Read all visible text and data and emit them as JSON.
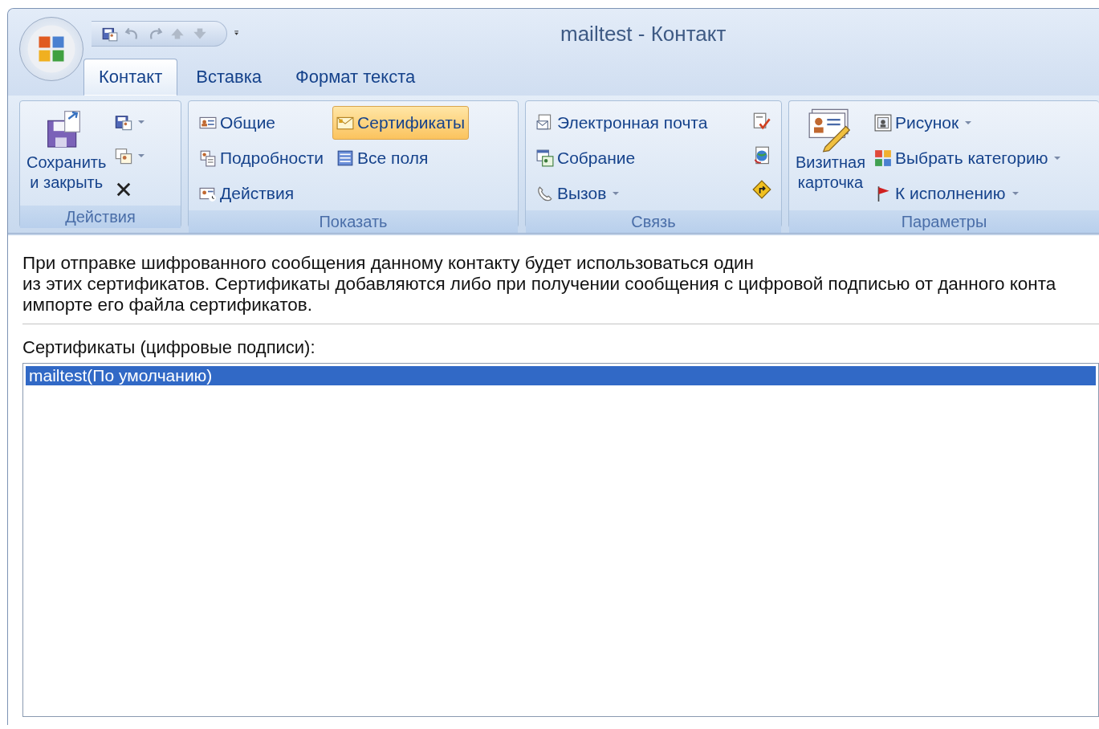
{
  "window": {
    "title": "mailtest - Контакт"
  },
  "tabs": [
    {
      "label": "Контакт",
      "selected": true
    },
    {
      "label": "Вставка",
      "selected": false
    },
    {
      "label": "Формат текста",
      "selected": false
    }
  ],
  "ribbon": {
    "groups": [
      {
        "label": "Действия",
        "columns": [
          [
            {
              "kind": "large",
              "lines": [
                "Сохранить",
                "и закрыть"
              ]
            }
          ],
          [
            {
              "kind": "icon",
              "dropdown": true
            },
            {
              "kind": "icon",
              "dropdown": true
            },
            {
              "kind": "icon",
              "dropdown": false
            }
          ]
        ]
      },
      {
        "label": "Показать",
        "columns": [
          [
            {
              "kind": "small",
              "label": "Общие",
              "selected": false
            },
            {
              "kind": "small",
              "label": "Подробности",
              "selected": false
            },
            {
              "kind": "small",
              "label": "Действия",
              "selected": false
            }
          ],
          [
            {
              "kind": "small",
              "label": "Сертификаты",
              "selected": true
            },
            {
              "kind": "small",
              "label": "Все поля",
              "selected": false
            }
          ]
        ]
      },
      {
        "label": "Связь",
        "columns": [
          [
            {
              "kind": "small",
              "label": "Электронная почта",
              "dropdown": false
            },
            {
              "kind": "small",
              "label": "Собрание",
              "dropdown": false
            },
            {
              "kind": "small",
              "label": "Вызов",
              "dropdown": true
            }
          ],
          [
            {
              "kind": "icon",
              "dropdown": false
            },
            {
              "kind": "icon",
              "dropdown": false
            },
            {
              "kind": "icon",
              "dropdown": false
            }
          ]
        ]
      },
      {
        "label": "Параметры",
        "columns": [
          [
            {
              "kind": "large",
              "lines": [
                "Визитная",
                "карточка"
              ]
            }
          ],
          [
            {
              "kind": "small",
              "label": "Рисунок",
              "dropdown": true
            },
            {
              "kind": "small",
              "label": "Выбрать категорию",
              "dropdown": true
            },
            {
              "kind": "small",
              "label": "К исполнению",
              "dropdown": true
            }
          ]
        ]
      }
    ]
  },
  "info": {
    "lines": [
      "При отправке шифрованного сообщения данному контакту будет использоваться один",
      "из этих сертификатов. Сертификаты добавляются либо при получении сообщения с цифровой подписью от данного конта",
      "импорте его файла сертификатов."
    ]
  },
  "certificates": {
    "label": "Сертификаты (цифровые подписи):",
    "items": [
      {
        "label": "mailtest(По умолчанию)",
        "selected": true
      }
    ]
  }
}
